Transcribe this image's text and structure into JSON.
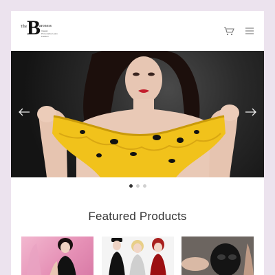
{
  "header": {
    "logo": {
      "prefix": "The",
      "initial": "B",
      "rest": "aroness",
      "tagline": "Classic Provocative Latex Fashion"
    },
    "icons": {
      "cart": "shopping-cart-icon",
      "menu": "hamburger-menu-icon"
    }
  },
  "slider": {
    "icons": {
      "prev": "arrow-left-icon",
      "next": "arrow-right-icon"
    },
    "dots": [
      true,
      false,
      false
    ]
  },
  "featured": {
    "title": "Featured Products"
  },
  "colors": {
    "background": "#ece3ee",
    "accent_yellow": "#f1c21b",
    "text": "#333333"
  }
}
